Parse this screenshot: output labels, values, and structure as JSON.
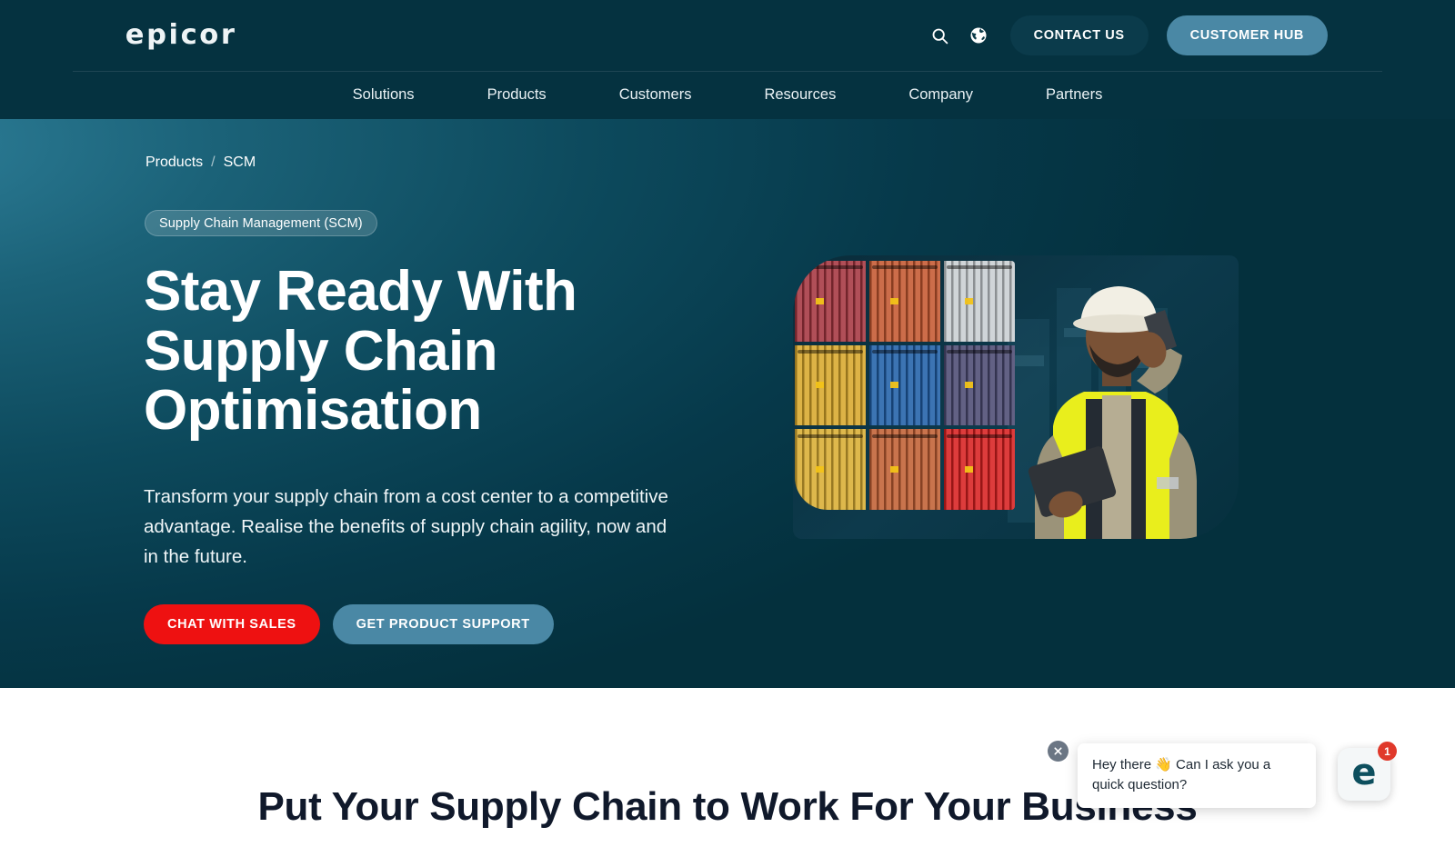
{
  "header": {
    "logo_text": "epicor",
    "search_icon": "search-icon",
    "globe_icon": "globe-icon",
    "contact_label": "CONTACT US",
    "hub_label": "CUSTOMER HUB",
    "nav": [
      {
        "label": "Solutions"
      },
      {
        "label": "Products"
      },
      {
        "label": "Customers"
      },
      {
        "label": "Resources"
      },
      {
        "label": "Company"
      },
      {
        "label": "Partners"
      }
    ]
  },
  "hero": {
    "breadcrumb": {
      "parent": "Products",
      "separator": "/",
      "current": "SCM"
    },
    "badge": "Supply Chain Management (SCM)",
    "title": "Stay Ready With Supply Chain Optimisation",
    "subtitle": "Transform your supply chain from a cost center to a competitive advantage. Realise the benefits of supply chain agility, now and in the future.",
    "cta_primary": "CHAT WITH SALES",
    "cta_secondary": "GET PRODUCT SUPPORT",
    "image_alt": "worker-with-hard-hat-and-hi-vis-vest-beside-shipping-containers",
    "container_colors": [
      "#a5353f",
      "#c4572f",
      "#c9cfd2",
      "#d8a82a",
      "#1f5fa8",
      "#4b4a72",
      "#d9ad32",
      "#c15f33",
      "#d81f1f"
    ],
    "colors": {
      "gradient_light": "#2e7f99",
      "gradient_dark": "#04303d",
      "accent_red": "#ee1111",
      "accent_blue": "#4a88a5"
    }
  },
  "section": {
    "heading": "Put Your Supply Chain to Work For Your Business"
  },
  "chat": {
    "message": "Hey there 👋 Can I ask you a quick question?",
    "unread_count": "1",
    "launcher_letter": "e",
    "close_icon": "close-icon"
  }
}
